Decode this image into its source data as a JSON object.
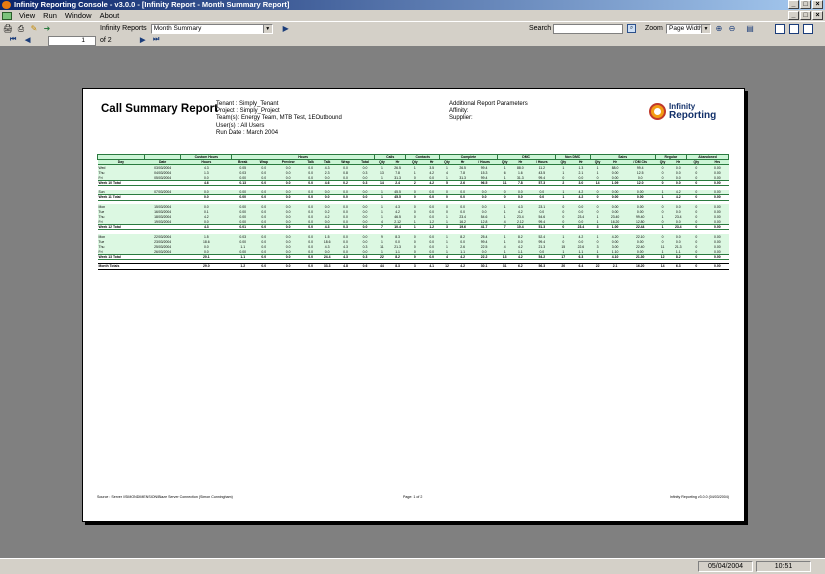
{
  "window": {
    "title": "Infinity Reporting Console - v3.0.0 - [Infinity Report - Month Summary Report]"
  },
  "menu": [
    "View",
    "Run",
    "Window",
    "About"
  ],
  "toolbar": {
    "reports_label": "Infinity Reports",
    "report_selected": "Month Summary",
    "search_label": "Search",
    "zoom_label": "Zoom",
    "zoom_value": "Page Width"
  },
  "nav": {
    "page": "1",
    "of": "of 2"
  },
  "report": {
    "title": "Call Summary Report",
    "tenant": "Tenant : Simply_Tenant",
    "project": "Project : Simply_Project",
    "teams": "Team(s): Energy Team, MTB Test, 1EOutbound",
    "users": "User(s) : All Users",
    "run_date": "Run Date : March 2004",
    "params_title": "Additional  Report Parameters",
    "affinity": "Affinity:",
    "supplier": "Supplier:",
    "logo_line1": "Infinity",
    "logo_line2": "Reporting"
  },
  "table": {
    "groups": [
      "",
      "",
      "Custom Hours",
      "Hours",
      "Calls",
      "Contacts",
      "Complete",
      "DMC",
      "Non DMC",
      "Sales",
      "Regular",
      "Abandoned"
    ],
    "columns": [
      "Day",
      "Date",
      "Hours",
      "Break",
      "Wrap",
      "Preview",
      "Talk",
      "Talk",
      "Wrap",
      "Total",
      "Qty",
      "Hr",
      "Qty",
      "Hr",
      "Qty",
      "Hr",
      "/ Hours",
      "Qty",
      "Hr",
      "/ Hours",
      "Qty",
      "Hr",
      "Qty",
      "Hr",
      "/ DM Cts",
      "Qty",
      "Hr",
      "Qty",
      "Hrs"
    ],
    "rows": [
      {
        "type": "day",
        "cells": [
          "Wed",
          "03/03/2004",
          "4.3",
          "0.05",
          "0.0",
          "0.0",
          "0.0",
          "4.3",
          "0.0",
          "0.0",
          "1",
          "26.5",
          "1",
          "3.5",
          "1",
          "26.5",
          "99.4",
          "1",
          "88.0",
          "11.2",
          "1",
          "1.3",
          "1",
          "88.0",
          "99.4",
          "0",
          "0.0",
          "0",
          "0.00"
        ]
      },
      {
        "type": "day",
        "cells": [
          "Thu",
          "04/03/2004",
          "1.3",
          "0.03",
          "0.0",
          "0.0",
          "0.0",
          "2.3",
          "0.8",
          "0.3",
          "13",
          "7.8",
          "1",
          "4.2",
          "4",
          "7.8",
          "15.3",
          "6",
          "1.6",
          "43.5",
          "1",
          "2.1",
          "1",
          "0.00",
          "12.5",
          "0",
          "0.0",
          "0",
          "0.00"
        ]
      },
      {
        "type": "day",
        "cells": [
          "Fri",
          "05/03/2004",
          "0.0",
          "0.00",
          "0.0",
          "0.0",
          "0.0",
          "0.0",
          "0.0",
          "0.0",
          "1",
          "31.3",
          "0",
          "0.0",
          "1",
          "31.3",
          "99.4",
          "1",
          "31.3",
          "99.4",
          "0",
          "0.0",
          "0",
          "0.00",
          "0.0",
          "0",
          "0.0",
          "0",
          "0.00"
        ]
      },
      {
        "type": "week",
        "cells": [
          "Week 10 Total",
          "",
          "4.6",
          "0.13",
          "0.0",
          "0.0",
          "0.0",
          "4.6",
          "0.2",
          "0.3",
          "14",
          "2.4",
          "2",
          "4.2",
          "5",
          "2.6",
          "96.5",
          "11",
          "7.8",
          "57.3",
          "2",
          "3.0",
          "14",
          "1.09",
          "12.0",
          "0",
          "0.0",
          "0",
          "0.00"
        ]
      },
      {
        "type": "gap",
        "cells": []
      },
      {
        "type": "day",
        "cells": [
          "Sun",
          "07/03/2004",
          "0.0",
          "0.00",
          "0.0",
          "0.0",
          "0.0",
          "0.0",
          "0.0",
          "0.0",
          "1",
          "45.5",
          "0",
          "0.0",
          "0",
          "0.0",
          "0.0",
          "0",
          "0.0",
          "0.0",
          "1",
          "4.2",
          "0",
          "0.00",
          "0.00",
          "1",
          "4.2",
          "0",
          "0.00"
        ]
      },
      {
        "type": "week",
        "cells": [
          "Week 11 Total",
          "",
          "0.0",
          "0.00",
          "0.0",
          "0.0",
          "0.0",
          "0.0",
          "0.0",
          "0.0",
          "1",
          "45.5",
          "0",
          "0.0",
          "0",
          "0.0",
          "0.0",
          "0",
          "0.0",
          "0.0",
          "1",
          "4.2",
          "0",
          "0.00",
          "0.00",
          "1",
          "4.2",
          "0",
          "0.00"
        ]
      },
      {
        "type": "gap",
        "cells": []
      },
      {
        "type": "day",
        "cells": [
          "Mon",
          "15/03/2004",
          "0.0",
          "0.00",
          "0.0",
          "0.0",
          "0.0",
          "0.0",
          "0.0",
          "0.0",
          "1",
          "4.3",
          "0",
          "0.0",
          "0",
          "0.0",
          "0.0",
          "1",
          "4.3",
          "23.1",
          "0",
          "0.0",
          "0",
          "0.00",
          "0.00",
          "0",
          "0.0",
          "0",
          "0.00"
        ]
      },
      {
        "type": "day",
        "cells": [
          "Tue",
          "16/03/2004",
          "0.1",
          "0.00",
          "0.0",
          "0.0",
          "0.0",
          "0.2",
          "0.0",
          "0.0",
          "1",
          "4.2",
          "0",
          "0.0",
          "0",
          "0.0",
          "0.0",
          "1",
          "4.2",
          "0.0",
          "0",
          "0.0",
          "0",
          "0.00",
          "0.00",
          "0",
          "0.0",
          "0",
          "0.00"
        ]
      },
      {
        "type": "day",
        "cells": [
          "Thu",
          "18/03/2004",
          "4.2",
          "0.00",
          "0.0",
          "0.0",
          "0.0",
          "4.2",
          "0.0",
          "0.0",
          "1",
          "46.5",
          "0",
          "0.0",
          "1",
          "23.4",
          "54.6",
          "1",
          "23.4",
          "54.6",
          "0",
          "23.4",
          "1",
          "23.40",
          "99.40",
          "1",
          "23.4",
          "0",
          "0.00"
        ]
      },
      {
        "type": "day",
        "cells": [
          "Fri",
          "19/03/2004",
          "0.0",
          "0.00",
          "0.0",
          "0.0",
          "0.0",
          "0.0",
          "0.0",
          "0.0",
          "4",
          "2.12",
          "1",
          "1.2",
          "1",
          "16.2",
          "12.8",
          "4",
          "2.12",
          "99.4",
          "0",
          "0.0",
          "1",
          "16.20",
          "12.80",
          "0",
          "0.0",
          "0",
          "0.00"
        ]
      },
      {
        "type": "week",
        "cells": [
          "Week 12 Total",
          "",
          "4.3",
          "0.01",
          "0.0",
          "0.0",
          "0.0",
          "4.3",
          "0.3",
          "0.0",
          "7",
          "10.4",
          "1",
          "1.2",
          "3",
          "19.6",
          "41.7",
          "7",
          "10.4",
          "51.3",
          "0",
          "23.4",
          "3",
          "1.00",
          "22.44",
          "1",
          "23.4",
          "0",
          "0.00"
        ]
      },
      {
        "type": "gap",
        "cells": []
      },
      {
        "type": "day",
        "cells": [
          "Mon",
          "22/03/2004",
          "1.5",
          "0.03",
          "0.0",
          "0.0",
          "0.0",
          "1.5",
          "0.0",
          "0.0",
          "9",
          "8.3",
          "0",
          "0.0",
          "1",
          "8.2",
          "25.4",
          "1",
          "8.2",
          "52.4",
          "1",
          "4.2",
          "1",
          "4.20",
          "22.10",
          "0",
          "0.0",
          "0",
          "0.00"
        ]
      },
      {
        "type": "day",
        "cells": [
          "Tue",
          "23/03/2004",
          "18.6",
          "0.00",
          "0.0",
          "0.0",
          "0.0",
          "18.6",
          "0.0",
          "0.0",
          "1",
          "0.0",
          "0",
          "0.0",
          "1",
          "0.0",
          "99.4",
          "1",
          "0.0",
          "99.4",
          "0",
          "0.0",
          "0",
          "0.00",
          "0.00",
          "0",
          "0.0",
          "0",
          "0.00"
        ]
      },
      {
        "type": "day",
        "cells": [
          "Thu",
          "25/03/2004",
          "0.0",
          "1.1",
          "0.0",
          "0.0",
          "0.0",
          "4.3",
          "4.3",
          "0.3",
          "11",
          "21.3",
          "0",
          "0.0",
          "1",
          "2.6",
          "22.5",
          "4",
          "4.2",
          "21.3",
          "15",
          "22.6",
          "3",
          "3.00",
          "22.40",
          "11",
          "21.3",
          "0",
          "0.00"
        ]
      },
      {
        "type": "day",
        "cells": [
          "Fri",
          "26/03/2004",
          "0.0",
          "0.00",
          "0.0",
          "0.0",
          "0.0",
          "0.0",
          "0.0",
          "0.0",
          "1",
          "1.1",
          "0",
          "0.0",
          "1",
          "1.1",
          "0.0",
          "1",
          "1.1",
          "0.0",
          "1",
          "1.1",
          "1",
          "1.10",
          "0.00",
          "1",
          "1.1",
          "0",
          "0.00"
        ]
      },
      {
        "type": "week",
        "cells": [
          "Week 13 Total",
          "",
          "20.1",
          "1.1",
          "0.0",
          "0.0",
          "0.0",
          "24.4",
          "4.3",
          "0.3",
          "22",
          "8.2",
          "0",
          "0.0",
          "4",
          "4.2",
          "22.2",
          "13",
          "4.2",
          "54.2",
          "17",
          "6.3",
          "5",
          "4.10",
          "21.30",
          "12",
          "8.2",
          "0",
          "0.00"
        ]
      },
      {
        "type": "gap",
        "cells": []
      },
      {
        "type": "month",
        "cells": [
          "Month Totals",
          "",
          "29.0",
          "1.2",
          "0.0",
          "0.0",
          "0.0",
          "33.3",
          "4.8",
          "0.6",
          "44",
          "8.3",
          "3",
          "4.1",
          "12",
          "4.2",
          "30.1",
          "31",
          "6.2",
          "56.3",
          "20",
          "6.4",
          "22",
          "2.1",
          "16.20",
          "14",
          "6.3",
          "0",
          "0.00"
        ]
      }
    ]
  },
  "footer": {
    "source": "Source : Server \\\\SIMONDIMENSION\\Blaze Server Connection (Simon Cunningham)",
    "page": "Page: 1 of 2",
    "version": "Infinity Reporting    v3.0.0 (04/03/2004)"
  },
  "status": {
    "date": "05/04/2004",
    "time": "10:51"
  }
}
